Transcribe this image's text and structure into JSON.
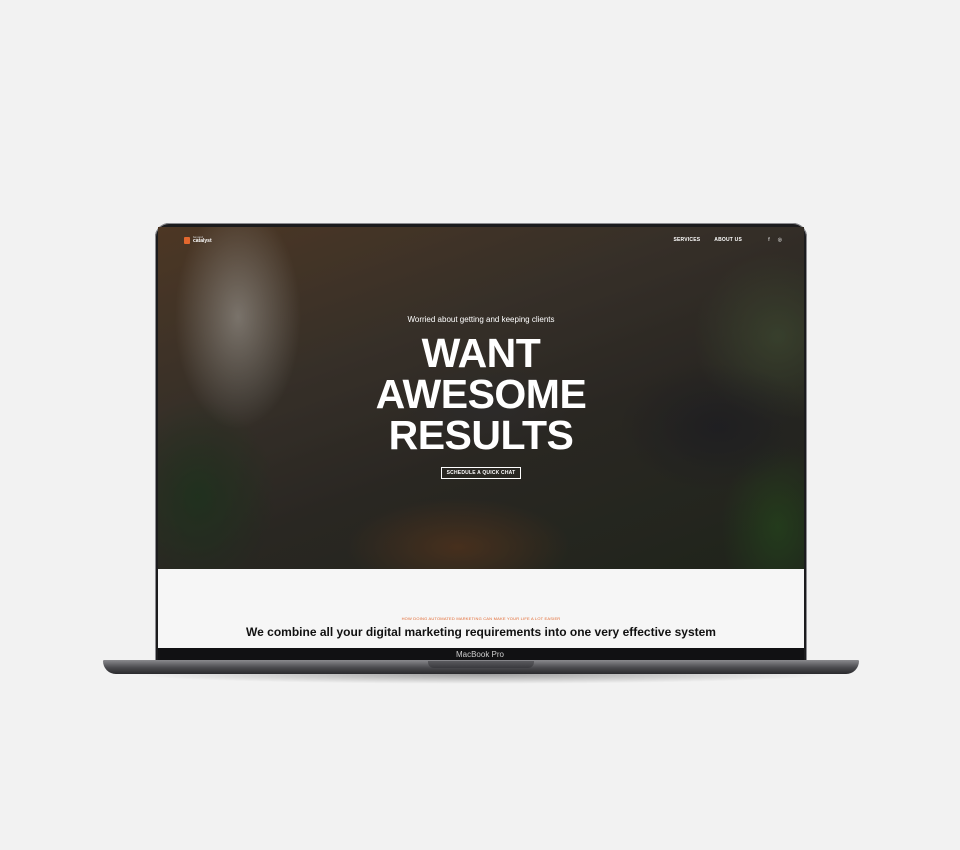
{
  "device": {
    "model_label": "MacBook Pro"
  },
  "site": {
    "logo": {
      "small_text": "beyond",
      "big_text": "catalyst"
    },
    "nav": {
      "links": [
        "SERVICES",
        "ABOUT US"
      ]
    },
    "social": {
      "icons": [
        "facebook-icon",
        "instagram-icon"
      ],
      "glyphs": [
        "f",
        "◎"
      ]
    },
    "hero": {
      "subtitle": "Worried about getting and keeping clients",
      "title_lines": [
        "WANT",
        "AWESOME",
        "RESULTS"
      ],
      "cta_label": "SCHEDULE A QUICK CHAT"
    },
    "content": {
      "eyebrow": "HOW DOING AUTOMATED MARKETING CAN MAKE YOUR LIFE A LOT EASIER",
      "heading": "We combine all your digital marketing requirements into one very effective system"
    }
  },
  "colors": {
    "accent": "#e2672e",
    "page_bg": "#f2f2f2"
  }
}
